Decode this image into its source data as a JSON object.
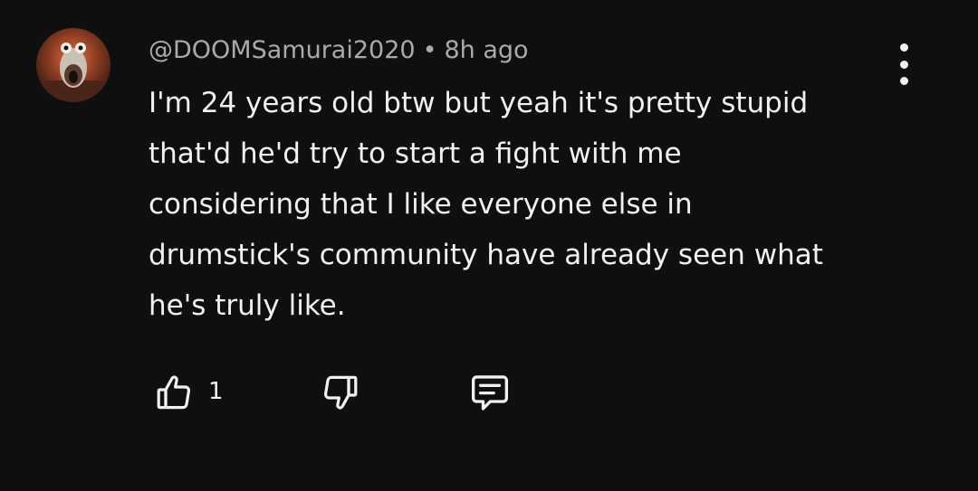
{
  "comment": {
    "author": "@DOOMSamurai2020",
    "separator": "•",
    "timestamp": "8h ago",
    "text": "I'm 24 years old btw but yeah it's pretty stupid\nthat'd he'd try to start a fight with me\nconsidering that I like everyone else in\ndrumstick's community have already seen what\nhe's truly like.",
    "like_count": "1"
  },
  "icons": {
    "avatar": "avatar-image",
    "menu": "more-vert-icon",
    "like": "thumb-up-icon",
    "dislike": "thumb-down-icon",
    "reply": "reply-comment-icon"
  },
  "colors": {
    "background": "#0f0f0f",
    "primary_text": "#f1f1f1",
    "secondary_text": "#aaaaaa"
  }
}
